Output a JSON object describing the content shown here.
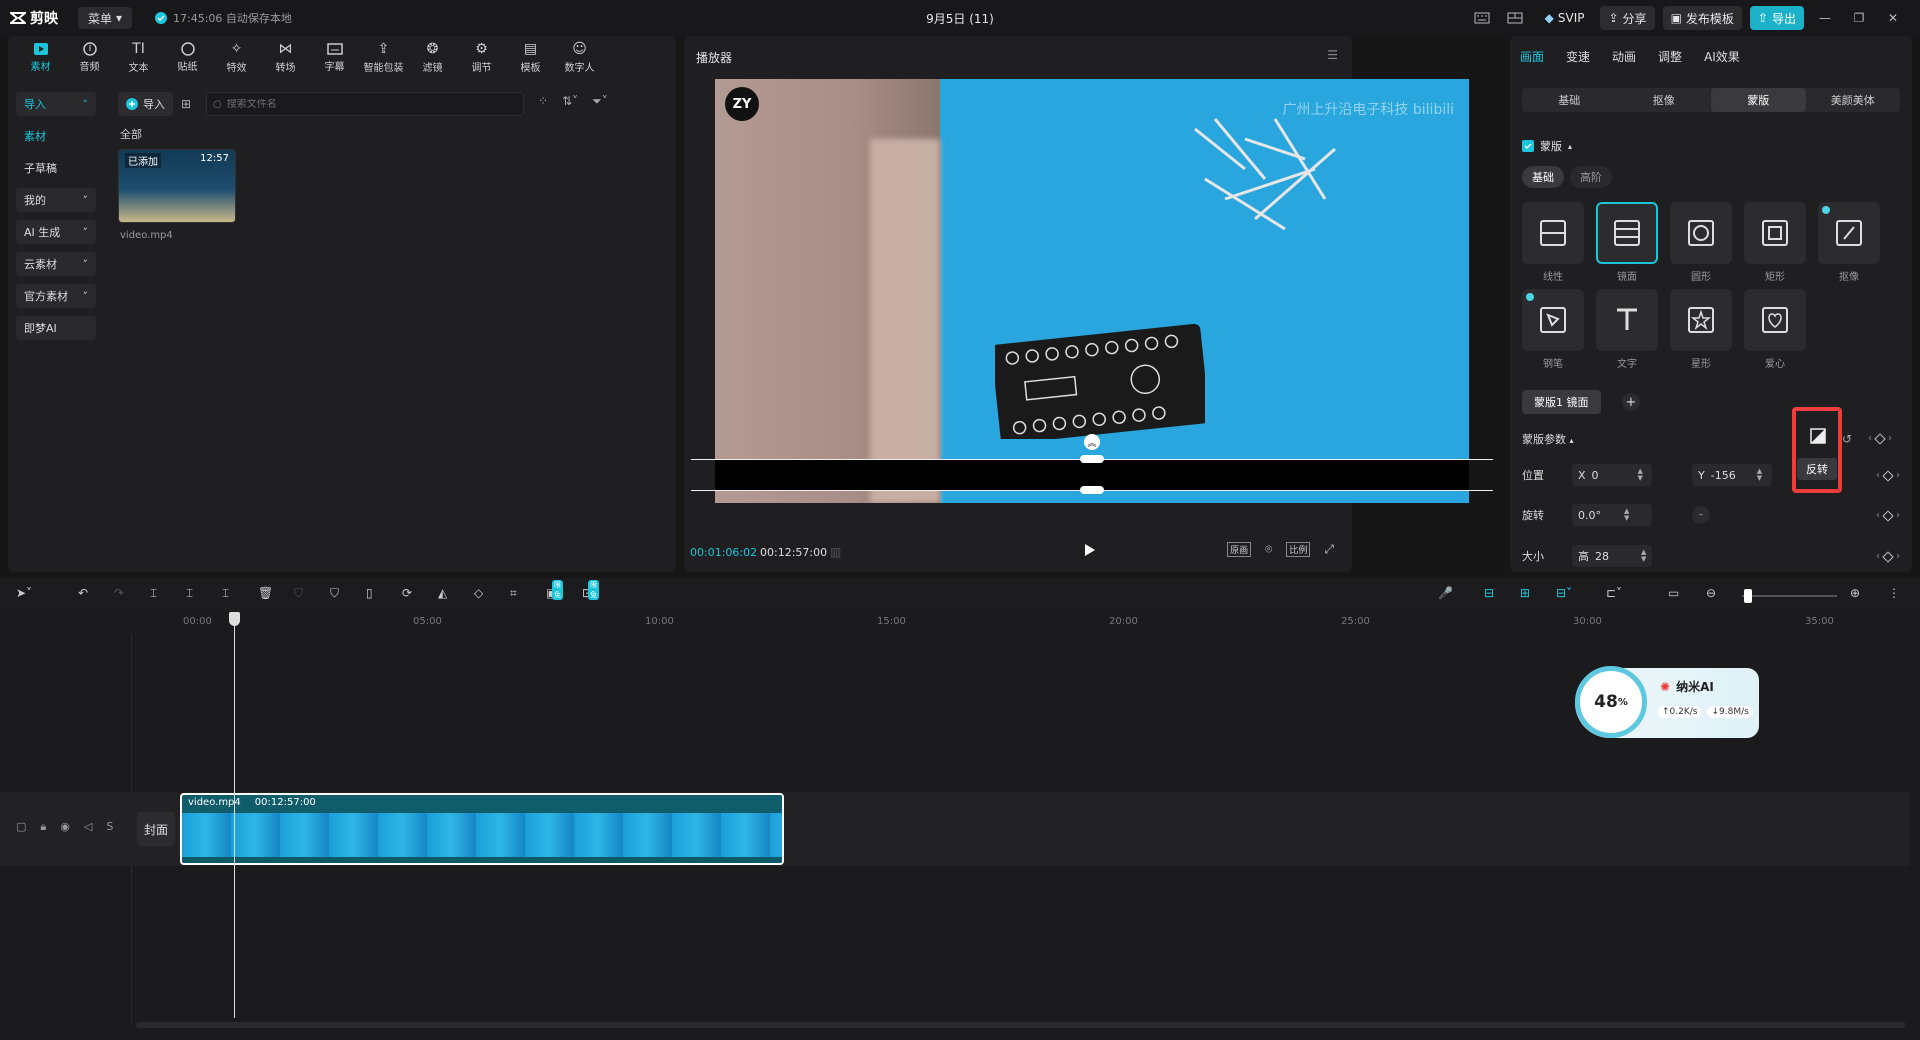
{
  "titlebar": {
    "app_name": "剪映",
    "menu_label": "菜单",
    "autosave_text": "17:45:06 自动保存本地",
    "project_title": "9月5日 (11)",
    "svip_label": "SVIP",
    "share_label": "分享",
    "publish_template_label": "发布模板",
    "export_label": "导出"
  },
  "left_panel": {
    "tools": [
      {
        "label": "素材",
        "icon": "media-icon",
        "active": true
      },
      {
        "label": "音频",
        "icon": "audio-icon"
      },
      {
        "label": "文本",
        "icon": "text-icon"
      },
      {
        "label": "贴纸",
        "icon": "sticker-icon"
      },
      {
        "label": "特效",
        "icon": "effects-icon"
      },
      {
        "label": "转场",
        "icon": "transition-icon"
      },
      {
        "label": "字幕",
        "icon": "subtitle-icon"
      },
      {
        "label": "智能包装",
        "icon": "smart-pack-icon"
      },
      {
        "label": "滤镜",
        "icon": "filter-icon"
      },
      {
        "label": "调节",
        "icon": "adjust-icon"
      },
      {
        "label": "模板",
        "icon": "template-icon"
      },
      {
        "label": "数字人",
        "icon": "avatar-icon"
      }
    ],
    "sidebar": [
      {
        "label": "导入",
        "expand": "up"
      },
      {
        "label": "素材"
      },
      {
        "label": "子草稿"
      },
      {
        "label": "我的",
        "expand": "down"
      },
      {
        "label": "AI 生成",
        "expand": "down"
      },
      {
        "label": "云素材",
        "expand": "down"
      },
      {
        "label": "官方素材",
        "expand": "down"
      },
      {
        "label": "即梦AI"
      }
    ],
    "import_label": "导入",
    "search_placeholder": "搜索文件名",
    "all_label": "全部",
    "media": {
      "added_badge": "已添加",
      "duration": "12:57",
      "name": "video.mp4"
    }
  },
  "player": {
    "title": "播放器",
    "watermark": "广州上升沿电子科技 bilibili",
    "logo_text": "ZY",
    "current_time": "00:01:06:02",
    "total_time": "00:12:57:00",
    "original_label": "原画",
    "ratio_label": "比例"
  },
  "right_panel": {
    "tabs": [
      "画面",
      "变速",
      "动画",
      "调整",
      "AI效果"
    ],
    "subtabs": [
      "基础",
      "抠像",
      "蒙版",
      "美颜美体"
    ],
    "mask_section": "蒙版",
    "mode_tabs": [
      "基础",
      "高阶"
    ],
    "shapes": [
      {
        "label": "线性",
        "icon": "linear-mask-icon"
      },
      {
        "label": "镜面",
        "icon": "mirror-mask-icon",
        "selected": true
      },
      {
        "label": "圆形",
        "icon": "circle-mask-icon"
      },
      {
        "label": "矩形",
        "icon": "rectangle-mask-icon"
      },
      {
        "label": "抠像",
        "icon": "cutout-mask-icon",
        "vip": true
      },
      {
        "label": "钢笔",
        "icon": "pen-mask-icon",
        "vip": true
      },
      {
        "label": "文字",
        "icon": "text-mask-icon"
      },
      {
        "label": "星形",
        "icon": "star-mask-icon"
      },
      {
        "label": "爱心",
        "icon": "heart-mask-icon"
      }
    ],
    "current_mask": "蒙版1 镜面",
    "params_label": "蒙版参数",
    "invert_tooltip": "反转",
    "position_label": "位置",
    "x_label": "X",
    "x_value": "0",
    "y_label": "Y",
    "y_value": "-156",
    "rotation_label": "旋转",
    "rotation_value": "0.0°",
    "size_label": "大小",
    "height_label": "高",
    "height_value": "28"
  },
  "timeline": {
    "free_badge": "限免",
    "ruler": [
      "00:00",
      "05:00",
      "10:00",
      "15:00",
      "20:00",
      "25:00",
      "30:00",
      "35:00"
    ],
    "cover_label": "封面",
    "clip_name": "video.mp4",
    "clip_duration": "00:12:57:00"
  },
  "nano_ai": {
    "percent": "48",
    "percent_unit": "%",
    "title": "纳米AI",
    "upload": "0.2K/s",
    "download": "9.8M/s"
  },
  "colors": {
    "accent": "#1bc6db",
    "highlight": "#ef3c3c"
  }
}
